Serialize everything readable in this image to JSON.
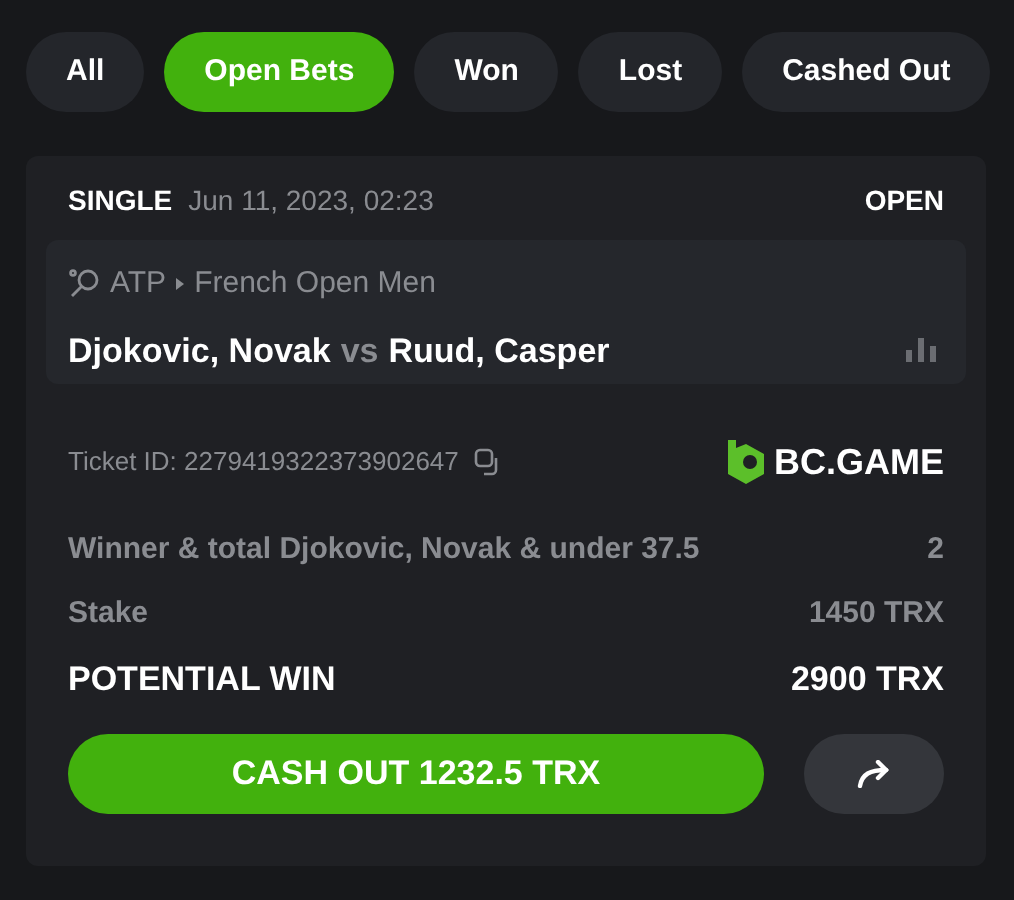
{
  "tabs": [
    {
      "label": "All",
      "selected": false
    },
    {
      "label": "Open Bets",
      "selected": true
    },
    {
      "label": "Won",
      "selected": false
    },
    {
      "label": "Lost",
      "selected": false
    },
    {
      "label": "Cashed Out",
      "selected": false
    }
  ],
  "bet": {
    "type": "SINGLE",
    "date": "Jun 11, 2023, 02:23",
    "status": "OPEN",
    "event": {
      "tour": "ATP",
      "tournament": "French Open Men",
      "home": "Djokovic, Novak",
      "vs": "vs",
      "away": "Ruud, Casper"
    },
    "ticket_id": "Ticket ID: 2279419322373902647",
    "brand": "BC.GAME",
    "selection": {
      "label": "Winner & total Djokovic, Novak & under 37.5",
      "odds": "2"
    },
    "stake": {
      "label": "Stake",
      "value": "1450 TRX"
    },
    "potential_win": {
      "label": "POTENTIAL WIN",
      "value": "2900 TRX"
    },
    "cash_out": "CASH OUT 1232.5 TRX"
  }
}
